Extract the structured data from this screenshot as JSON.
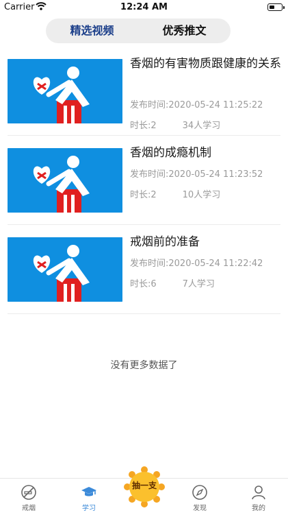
{
  "status_bar": {
    "carrier": "Carrier",
    "time": "12:24 AM"
  },
  "tabs": [
    {
      "label": "精选视频",
      "active": true
    },
    {
      "label": "优秀推文",
      "active": false
    }
  ],
  "videos": [
    {
      "title": "香烟的有害物质跟健康的关系",
      "published": "发布时间:2020-05-24 11:25:22",
      "duration": "时长:2",
      "learners": "34人学习"
    },
    {
      "title": "香烟的成瘾机制",
      "published": "发布时间:2020-05-24 11:23:52",
      "duration": "时长:2",
      "learners": "10人学习"
    },
    {
      "title": "戒烟前的准备",
      "published": "发布时间:2020-05-24 11:22:42",
      "duration": "时长:6",
      "learners": "7人学习"
    }
  ],
  "no_more_text": "没有更多数据了",
  "tabbar": {
    "items": [
      {
        "label": "戒烟",
        "icon": "no-smoking-icon"
      },
      {
        "label": "学习",
        "icon": "graduation-cap-icon",
        "active": true
      },
      {
        "label": "发现",
        "icon": "compass-icon"
      },
      {
        "label": "我的",
        "icon": "user-icon"
      }
    ],
    "center_button": "抽一支"
  },
  "colors": {
    "accent": "#1c3f8a",
    "thumbnail_bg": "#0f8fe0",
    "active_tab": "#3b8ad9",
    "center_button": "#f5a623"
  }
}
